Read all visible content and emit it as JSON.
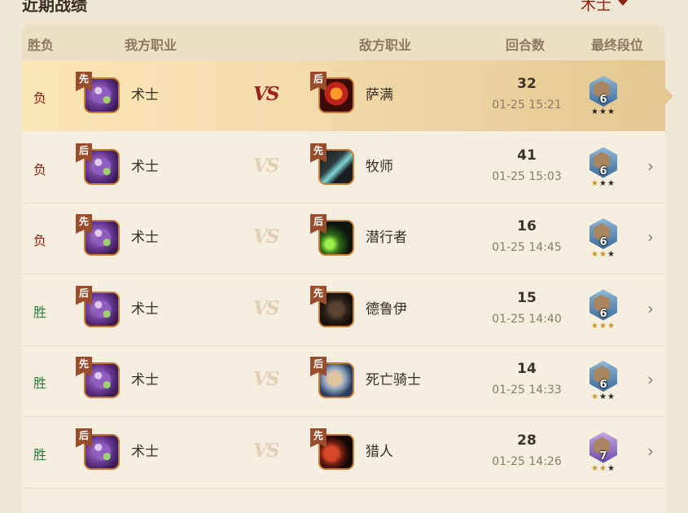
{
  "page": {
    "title": "近期战绩",
    "filter_label": "术士"
  },
  "header": {
    "result": "胜负",
    "my_class": "我方职业",
    "enemy_class": "敌方职业",
    "turns": "回合数",
    "final_rank": "最终段位"
  },
  "colors": {
    "lose": "#8c1c10",
    "win": "#2d7b3a",
    "accent": "#8f1f12",
    "selected_row": "#f4dcad"
  },
  "rows": [
    {
      "result": "负",
      "my_order": "先",
      "my_class": "术士",
      "vs": "VS",
      "enemy_order": "后",
      "enemy_class": "萨满",
      "enemy_icon": "shaman-portrait-icon",
      "turns": "32",
      "time": "01-25 15:21",
      "rank": "6",
      "stars_on": 0,
      "selected": true
    },
    {
      "result": "负",
      "my_order": "后",
      "my_class": "术士",
      "vs": "VS",
      "enemy_order": "先",
      "enemy_class": "牧师",
      "enemy_icon": "priest-portrait-icon",
      "turns": "41",
      "time": "01-25 15:03",
      "rank": "6",
      "stars_on": 1,
      "selected": false
    },
    {
      "result": "负",
      "my_order": "先",
      "my_class": "术士",
      "vs": "VS",
      "enemy_order": "后",
      "enemy_class": "潜行者",
      "enemy_icon": "rogue-portrait-icon",
      "turns": "16",
      "time": "01-25 14:45",
      "rank": "6",
      "stars_on": 2,
      "selected": false
    },
    {
      "result": "胜",
      "my_order": "后",
      "my_class": "术士",
      "vs": "VS",
      "enemy_order": "先",
      "enemy_class": "德鲁伊",
      "enemy_icon": "druid-portrait-icon",
      "turns": "15",
      "time": "01-25 14:40",
      "rank": "6",
      "stars_on": 3,
      "selected": false
    },
    {
      "result": "胜",
      "my_order": "先",
      "my_class": "术士",
      "vs": "VS",
      "enemy_order": "后",
      "enemy_class": "死亡骑士",
      "enemy_icon": "death-knight-portrait-icon",
      "turns": "14",
      "time": "01-25 14:33",
      "rank": "6",
      "stars_on": 1,
      "selected": false
    },
    {
      "result": "胜",
      "my_order": "后",
      "my_class": "术士",
      "vs": "VS",
      "enemy_order": "先",
      "enemy_class": "猎人",
      "enemy_icon": "hunter-portrait-icon",
      "turns": "28",
      "time": "01-25 14:26",
      "rank": "7",
      "stars_on": 2,
      "selected": false
    }
  ]
}
